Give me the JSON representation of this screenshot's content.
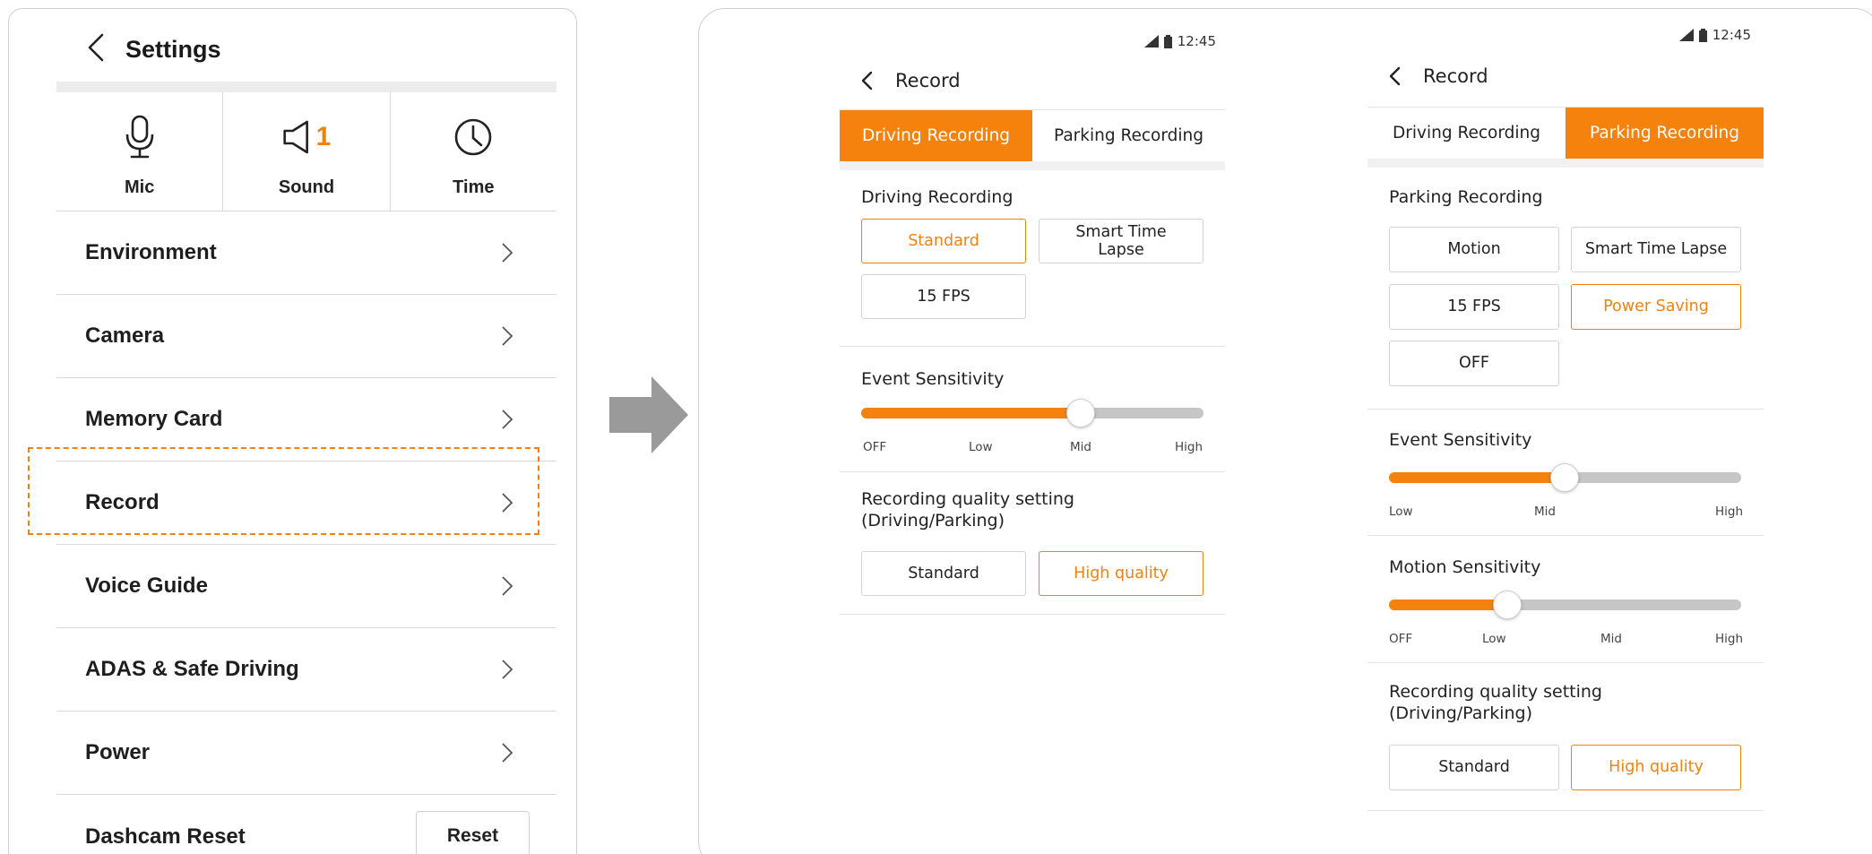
{
  "settings": {
    "title": "Settings",
    "quick": [
      {
        "label": "Mic",
        "icon": "mic-icon"
      },
      {
        "label": "Sound",
        "icon": "speaker-icon",
        "badge": "1"
      },
      {
        "label": "Time",
        "icon": "clock-icon"
      }
    ],
    "menu": [
      {
        "label": "Environment"
      },
      {
        "label": "Camera"
      },
      {
        "label": "Memory Card"
      },
      {
        "label": "Record",
        "highlighted": true
      },
      {
        "label": "Voice Guide"
      },
      {
        "label": "ADAS & Safe Driving"
      },
      {
        "label": "Power"
      },
      {
        "label": "Dashcam Reset",
        "button": "Reset"
      }
    ],
    "accent_color": "#f0820f"
  },
  "driving_screen": {
    "time": "12:45",
    "title": "Record",
    "tabs": [
      "Driving Recording",
      "Parking Recording"
    ],
    "active_tab": 0,
    "mode_section": {
      "title": "Driving Recording",
      "options": [
        "Standard",
        "Smart Time Lapse",
        "15 FPS"
      ],
      "selected": "Standard"
    },
    "event_sensitivity": {
      "title": "Event Sensitivity",
      "ticks": [
        "OFF",
        "Low",
        "Mid",
        "High"
      ],
      "value": "Mid",
      "fill_fraction": 0.64
    },
    "quality": {
      "title_line1": "Recording quality setting",
      "title_line2": "(Driving/Parking)",
      "options": [
        "Standard",
        "High quality"
      ],
      "selected": "High quality"
    }
  },
  "parking_screen": {
    "time": "12:45",
    "title": "Record",
    "tabs": [
      "Driving Recording",
      "Parking Recording"
    ],
    "active_tab": 1,
    "mode_section": {
      "title": "Parking Recording",
      "options": [
        "Motion",
        "Smart Time Lapse",
        "15 FPS",
        "Power Saving",
        "OFF"
      ],
      "selected": "Power Saving"
    },
    "event_sensitivity": {
      "title": "Event Sensitivity",
      "ticks": [
        "Low",
        "Mid",
        "High"
      ],
      "value": "Mid",
      "fill_fraction": 0.5
    },
    "motion_sensitivity": {
      "title": "Motion Sensitivity",
      "ticks": [
        "OFF",
        "Low",
        "Mid",
        "High"
      ],
      "value": "Low",
      "fill_fraction": 0.34
    },
    "quality": {
      "title_line1": "Recording quality setting",
      "title_line2": "(Driving/Parking)",
      "options": [
        "Standard",
        "High quality"
      ],
      "selected": "High quality"
    }
  }
}
